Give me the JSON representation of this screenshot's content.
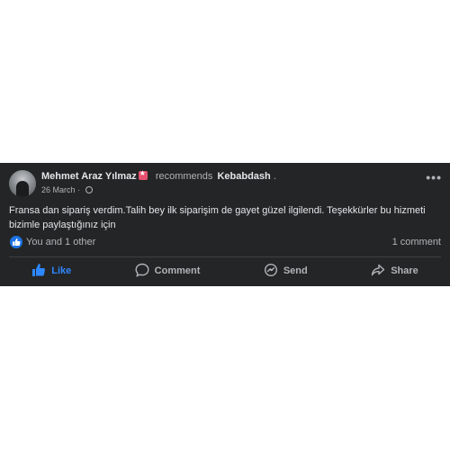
{
  "post": {
    "author": "Mehmet Araz Yılmaz",
    "recommends_text": "recommends",
    "page_name": "Kebabdash",
    "page_suffix": ".",
    "date": "26 March",
    "date_separator": "·",
    "text": "Fransa dan sipariş verdim.Talih bey ilk siparişim de gayet güzel ilgilendi. Teşekkürler bu hizmeti bizimle paylaştığınız için",
    "reactions_text": "You and 1 other",
    "comments_text": "1 comment",
    "more_label": "•••"
  },
  "actions": {
    "like": "Like",
    "comment": "Comment",
    "send": "Send",
    "share": "Share"
  },
  "colors": {
    "card_bg": "#242526",
    "like_blue": "#2d88ff",
    "badge_pink": "#e8506f"
  },
  "icons": [
    "globe-icon",
    "more-icon",
    "like-reaction-icon",
    "like-icon",
    "comment-icon",
    "send-icon",
    "share-icon",
    "recommendation-badge-icon"
  ]
}
